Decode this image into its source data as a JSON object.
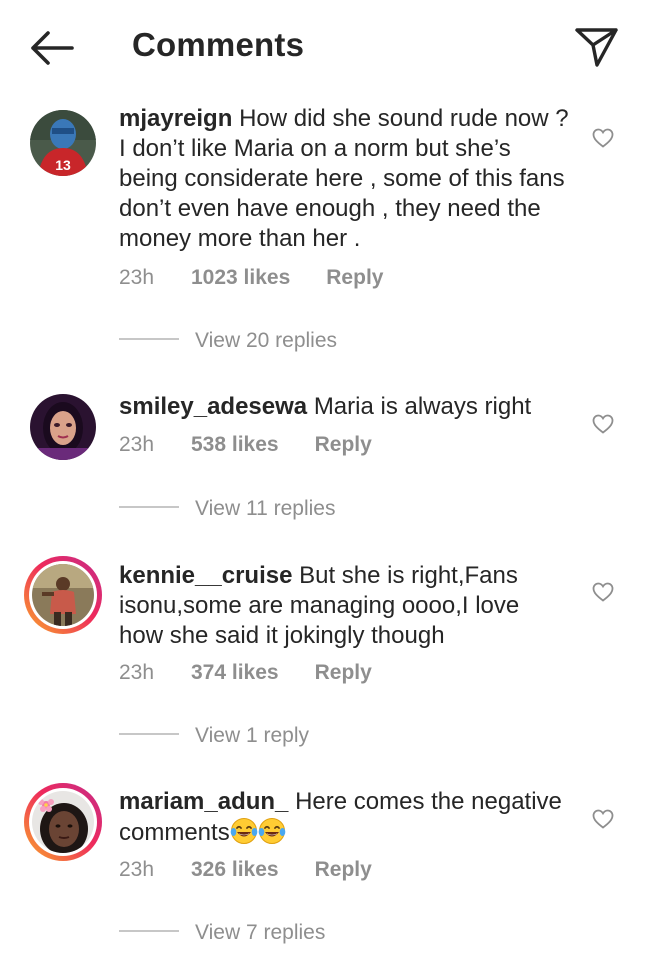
{
  "header": {
    "title": "Comments",
    "back_icon": "arrow-left-icon",
    "share_icon": "paper-plane-icon"
  },
  "colors": {
    "text": "#262626",
    "muted": "#8e8e8e",
    "divider": "#c7c7c7",
    "story_ring_start": "#f9a72b",
    "story_ring_end": "#c42c8a"
  },
  "comments": [
    {
      "username": "mjayreign",
      "text": "How did she sound rude now ? I don’t like Maria on a norm but she’s being considerate here , some of this fans don’t even have enough , they need the money more than her .",
      "time": "23h",
      "likes": "1023 likes",
      "reply": "Reply",
      "view_replies": "View 20 replies"
    },
    {
      "username": "smiley_adesewa",
      "text": "Maria is always right",
      "time": "23h",
      "likes": "538 likes",
      "reply": "Reply",
      "view_replies": "View 11 replies"
    },
    {
      "username": "kennie__cruise",
      "text": "But she is right,Fans isonu,some are managing oooo,I love how she said it jokingly though",
      "time": "23h",
      "likes": "374 likes",
      "reply": "Reply",
      "view_replies": "View 1 reply"
    },
    {
      "username": "mariam_adun_",
      "text": "Here comes the negative comments",
      "emoji": "face-with-tears-of-joy x2",
      "time": "23h",
      "likes": "326 likes",
      "reply": "Reply",
      "view_replies": "View 7 replies"
    }
  ]
}
